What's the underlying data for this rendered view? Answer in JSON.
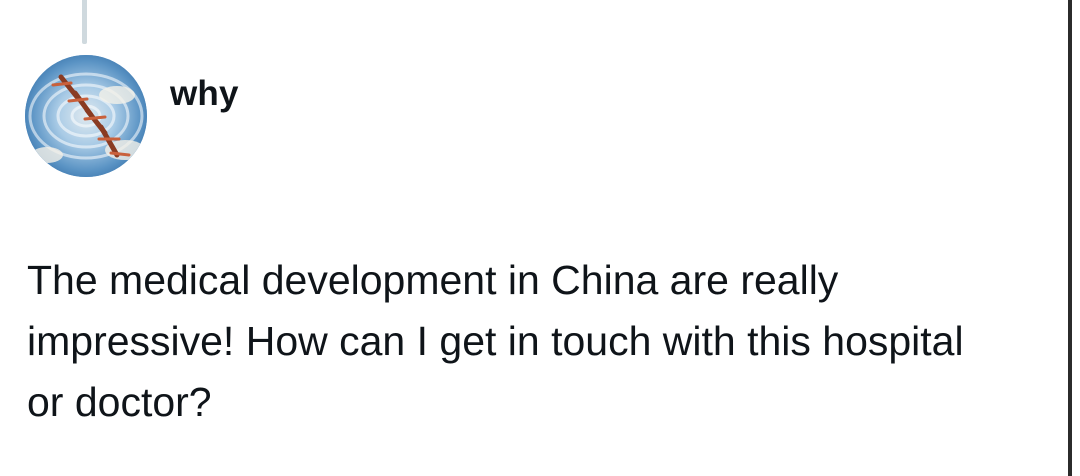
{
  "post": {
    "author_name": "why",
    "text": "The medical development in China are really impressive! How can I get in touch with this hospital or doctor?"
  },
  "icons": {
    "avatar": "profile-avatar-image"
  }
}
